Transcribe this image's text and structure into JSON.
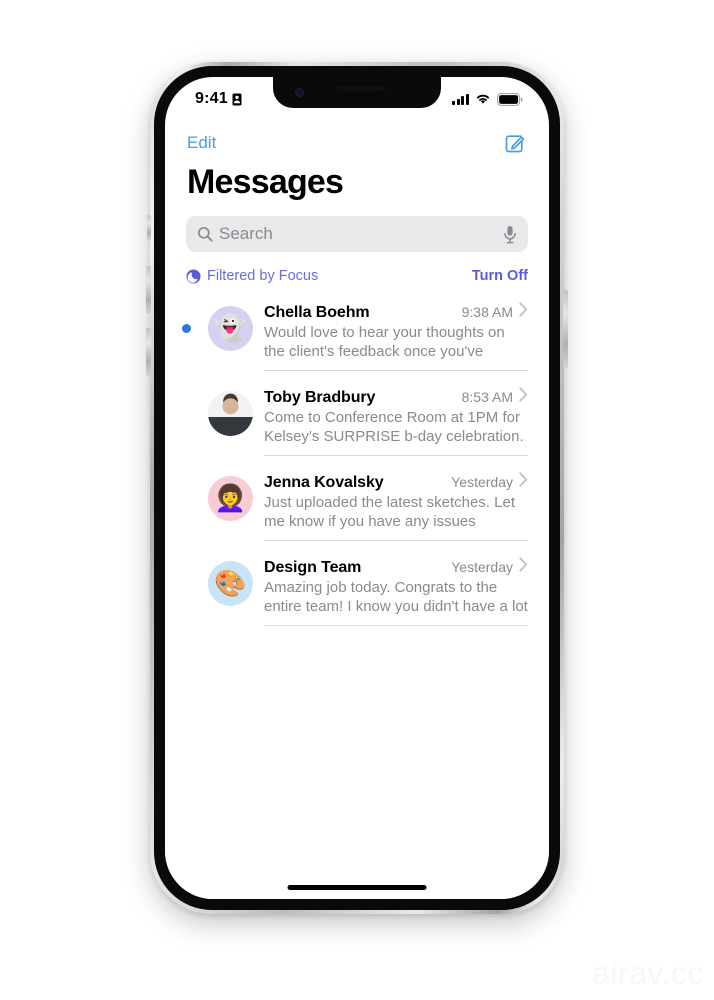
{
  "status_bar": {
    "time": "9:41",
    "icons": [
      "id-card-icon",
      "cellular-signal-icon",
      "wifi-icon",
      "battery-icon"
    ],
    "signal_bars": 4,
    "battery_full": true
  },
  "nav": {
    "edit_label": "Edit",
    "compose_icon": "compose-icon",
    "accent_color": "#4a9de0"
  },
  "header": {
    "title": "Messages"
  },
  "search": {
    "placeholder": "Search",
    "value": "",
    "search_icon": "search-icon",
    "dictation_icon": "microphone-icon"
  },
  "focus": {
    "icon": "moon-focus-icon",
    "label": "Filtered by Focus",
    "action_label": "Turn Off",
    "accent_color": "#5b5bd6"
  },
  "conversations": [
    {
      "name": "Chella Boehm",
      "time": "9:38 AM",
      "preview": "Would love to hear your thoughts on the client's feedback once you've finished th…",
      "unread": true,
      "avatar": {
        "type": "memoji",
        "glyph": "👻",
        "bg": "#d7d0f0",
        "name": "ghost-memoji-avatar"
      }
    },
    {
      "name": "Toby Bradbury",
      "time": "8:53 AM",
      "preview": "Come to Conference Room at 1PM for Kelsey's SURPRISE b-day celebration.",
      "unread": false,
      "avatar": {
        "type": "photo",
        "glyph": "",
        "bg": "#f0f0f0",
        "name": "photo-avatar"
      }
    },
    {
      "name": "Jenna Kovalsky",
      "time": "Yesterday",
      "preview": "Just uploaded the latest sketches. Let me know if you have any issues accessing.",
      "unread": false,
      "avatar": {
        "type": "memoji",
        "glyph": "👩‍🦱",
        "bg": "#f8ccd4",
        "name": "curly-hair-memoji-avatar"
      }
    },
    {
      "name": "Design Team",
      "time": "Yesterday",
      "preview": "Amazing job today. Congrats to the entire team! I know you didn't have a lot of tim…",
      "unread": false,
      "avatar": {
        "type": "emoji",
        "glyph": "🎨",
        "bg": "#c9e4f6",
        "name": "palette-emoji-avatar"
      }
    }
  ],
  "watermark": {
    "text": "airav.cc"
  }
}
